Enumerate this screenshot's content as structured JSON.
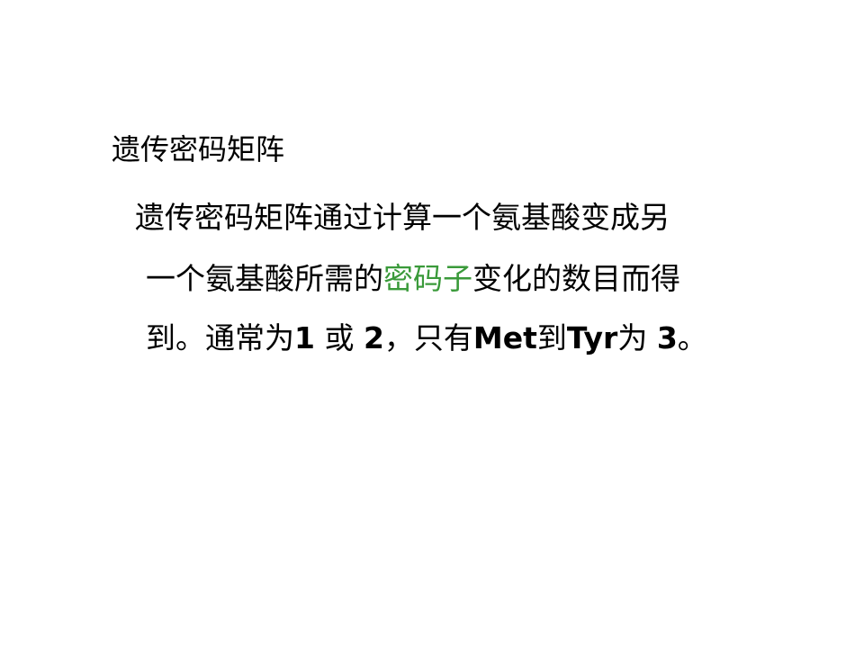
{
  "heading": "遗传密码矩阵",
  "paragraph": {
    "line1": "遗传密码矩阵通过计算一个氨基酸变成另",
    "line2_before": "一个氨基酸所需的",
    "line2_highlight": "密码子",
    "line2_after": "变化的数目而得",
    "line3_part1": "到。通常为",
    "line3_num1": "1",
    "line3_part2": " 或 ",
    "line3_num2": "2",
    "line3_part3": "，只有",
    "line3_met": "Met",
    "line3_part4": "到",
    "line3_tyr": "Tyr",
    "line3_part5": "为 ",
    "line3_num3": "3",
    "line3_part6": "。"
  },
  "colors": {
    "highlight": "#3a9a3a",
    "text": "#000000",
    "background": "#ffffff"
  }
}
